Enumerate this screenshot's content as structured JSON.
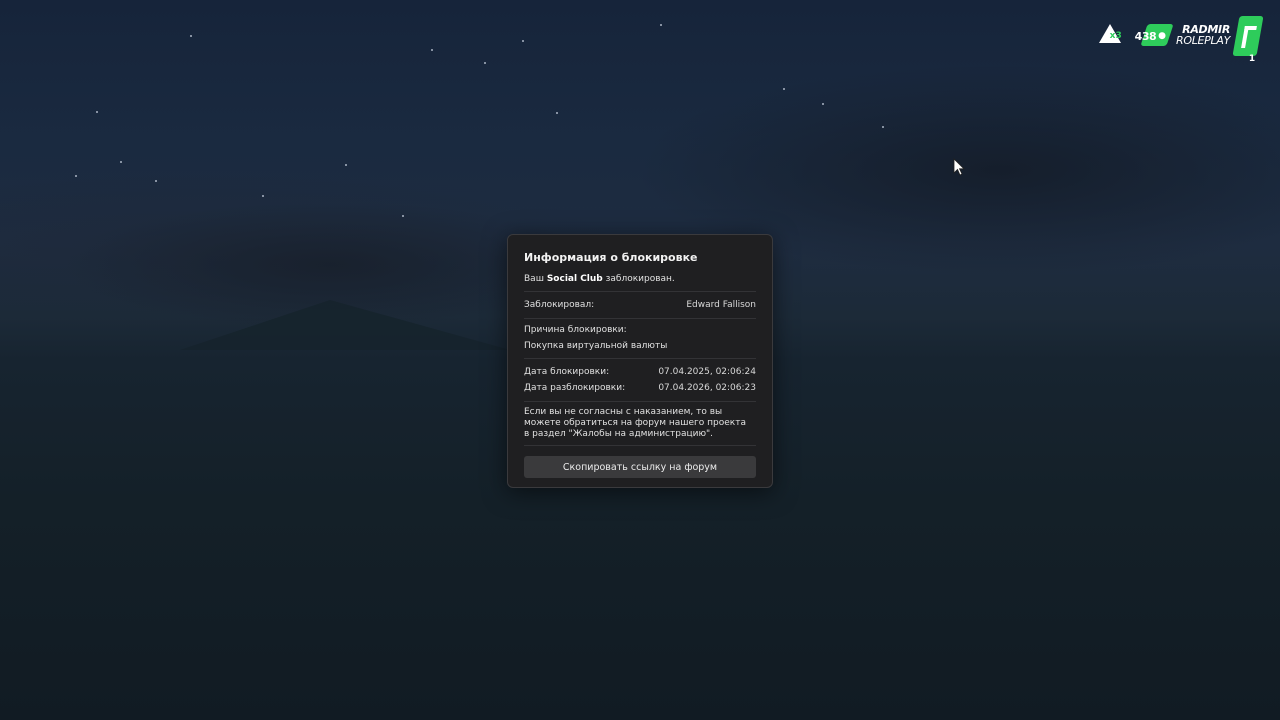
{
  "hud": {
    "badge_icon": "triangle-badge-icon",
    "badge_multiplier": "x3",
    "online_count": "438",
    "online_icon": "user-icon",
    "logo_line1": "RADMIR",
    "logo_line2": "ROLEPLAY",
    "server_number": "1",
    "accent_color": "#2ecc5b"
  },
  "modal": {
    "title": "Информация о блокировке",
    "intro_prefix": "Ваш",
    "intro_bold": "Social Club",
    "intro_suffix": "заблокирован.",
    "blocked_by_label": "Заблокировал:",
    "blocked_by_value": "Edward Fallison",
    "reason_label": "Причина блокировки:",
    "reason_value": "Покупка виртуальной валюты",
    "block_date_label": "Дата блокировки:",
    "block_date_value": "07.04.2025, 02:06:24",
    "unblock_date_label": "Дата разблокировки:",
    "unblock_date_value": "07.04.2026, 02:06:23",
    "notice": "Если вы не согласны с наказанием, то вы можете обратиться на форум нашего проекта в раздел \"Жалобы на администрацию\".",
    "copy_button_label": "Скопировать ссылку на форум"
  }
}
